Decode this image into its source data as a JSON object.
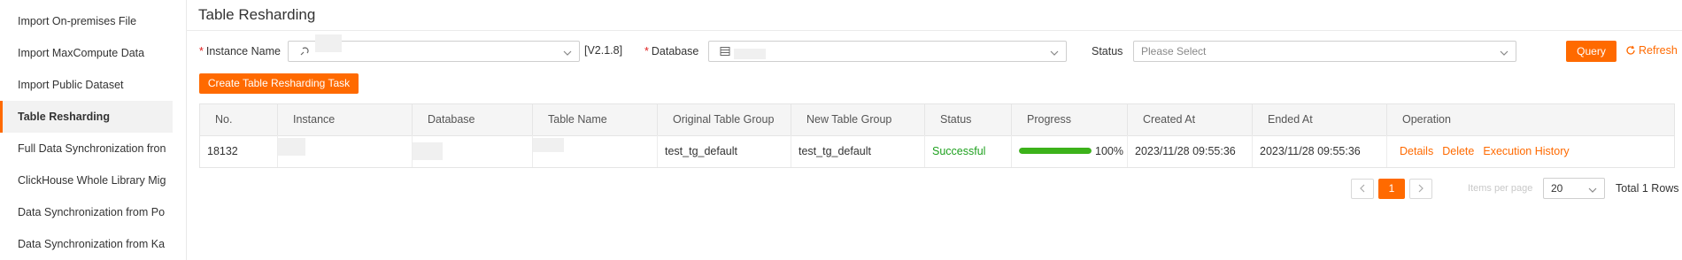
{
  "sidebar": {
    "items": [
      {
        "label": "Import On-premises File",
        "active": false
      },
      {
        "label": "Import MaxCompute Data",
        "active": false
      },
      {
        "label": "Import Public Dataset",
        "active": false
      },
      {
        "label": "Table Resharding",
        "active": true
      },
      {
        "label": "Full Data Synchronization fron",
        "active": false
      },
      {
        "label": "ClickHouse Whole Library Mig",
        "active": false
      },
      {
        "label": "Data Synchronization from Po",
        "active": false
      },
      {
        "label": "Data Synchronization from Ka",
        "active": false
      }
    ]
  },
  "page": {
    "title": "Table Resharding"
  },
  "filters": {
    "required_mark": "*",
    "instance_label": "Instance Name",
    "instance_version": "[V2.1.8]",
    "database_label": "Database",
    "status_label": "Status",
    "status_placeholder": "Please Select",
    "query_label": "Query",
    "refresh_label": "Refresh"
  },
  "actions": {
    "create_task_label": "Create Table Resharding Task"
  },
  "table": {
    "columns": [
      "No.",
      "Instance",
      "Database",
      "Table Name",
      "Original Table Group",
      "New Table Group",
      "Status",
      "Progress",
      "Created At",
      "Ended At",
      "Operation"
    ],
    "rows": [
      {
        "no": "18132",
        "instance": "",
        "database": "",
        "table_name": "",
        "original_table_group": "test_tg_default",
        "new_table_group": "test_tg_default",
        "status": "Successful",
        "progress": 1.0,
        "progress_label": "100%",
        "created_at": "2023/11/28 09:55:36",
        "ended_at": "2023/11/28 09:55:36",
        "operations": [
          "Details",
          "Delete",
          "Execution History"
        ]
      }
    ]
  },
  "pagination": {
    "current_page": "1",
    "items_per_page_label": "Items per page",
    "page_size": "20",
    "total_label": "Total 1 Rows"
  },
  "colors": {
    "accent": "#ff6a00",
    "success": "#1fa11f",
    "progress": "#3cb21a"
  }
}
